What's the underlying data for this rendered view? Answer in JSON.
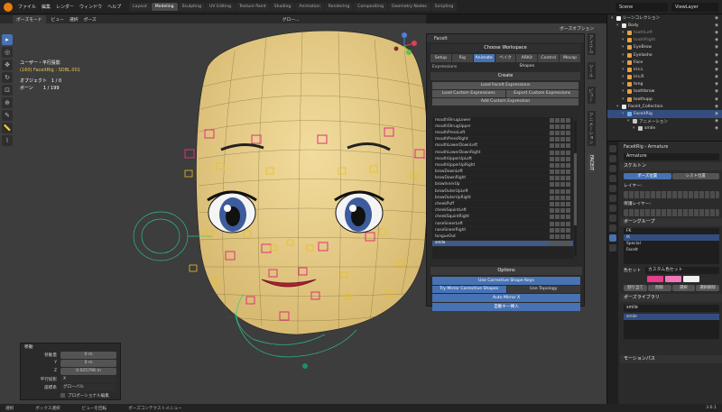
{
  "topbar": {
    "menu": [
      "ファイル",
      "編集",
      "レンダー",
      "ウィンドウ",
      "ヘルプ"
    ],
    "workspaces": [
      "Layout",
      "Modeling",
      "Sculpting",
      "UV Editing",
      "Texture Paint",
      "Shading",
      "Animation",
      "Rendering",
      "Compositing",
      "Geometry Nodes",
      "Scripting"
    ],
    "active_workspace": "Modeling",
    "scene": "Scene",
    "view_layer": "ViewLayer"
  },
  "viewport_header": {
    "mode": "ポーズモード",
    "items": [
      "ビュー",
      "選択",
      "ポーズ"
    ],
    "transform": "グロー...",
    "pose_options": "ポーズオプション"
  },
  "overlay": {
    "line1": "ユーザー・平行投影",
    "line2": "(160) FaceitRig : SDBL.001",
    "line3_label": "オブジェクト",
    "line3_value": "1 / 0",
    "line4_label": "ボーン",
    "line4_value": "1 / 199"
  },
  "faceit": {
    "header": "FaceIt",
    "workspace_title": "Choose Workspace",
    "tabs": [
      "Setup",
      "Rig",
      "Animate",
      "ベイク",
      "ARKit Shapes",
      "Control",
      "Mocap"
    ],
    "active_tab": "Animate",
    "expressions_label": "Expressions",
    "create_label": "Create",
    "load_preset": "Load FaceIt Expressions",
    "load_custom": "Load Custom Expressions",
    "export_custom": "Export Custom Expressions",
    "add_custom": "Add Custom Expression",
    "expressions": [
      "mouthShrugLower",
      "mouthShrugUpper",
      "mouthPressLeft",
      "mouthPressRight",
      "mouthLowerDownLeft",
      "mouthLowerDownRight",
      "mouthUpperUpLeft",
      "mouthUpperUpRight",
      "browDownLeft",
      "browDownRight",
      "browInnerUp",
      "browOuterUpLeft",
      "browOuterUpRight",
      "cheekPuff",
      "cheekSquintLeft",
      "cheekSquintRight",
      "noseSneerLeft",
      "noseSneerRight",
      "tongueOut",
      "smile"
    ],
    "selected_expression": "smile",
    "options_label": "Options",
    "opt1": "Use Corrective Shape Keys",
    "opt2": "Try Mirror Corrective Shapes",
    "opt3": "Use Topology",
    "opt4": "Auto Mirror X",
    "opt5": "自動キー挿入"
  },
  "side_tabs": [
    "アイテム",
    "ツール",
    "ビュー",
    "アニメーション",
    "FACEIT"
  ],
  "outliner": {
    "rows": [
      {
        "label": "シーンコレクション",
        "indent": 0,
        "color": "#ffffff",
        "dim": false,
        "sel": false
      },
      {
        "label": "Body",
        "indent": 1,
        "color": "#e8e8e8",
        "dim": false,
        "sel": false
      },
      {
        "label": "toothLeft",
        "indent": 2,
        "color": "#e8a040",
        "dim": true,
        "sel": false
      },
      {
        "label": "toothRight",
        "indent": 2,
        "color": "#e8a040",
        "dim": true,
        "sel": false
      },
      {
        "label": "EyeBrow",
        "indent": 2,
        "color": "#e8a040",
        "dim": false,
        "sel": false
      },
      {
        "label": "Eyelashe",
        "indent": 2,
        "color": "#e8a040",
        "dim": false,
        "sel": false
      },
      {
        "label": "Face",
        "indent": 2,
        "color": "#e8a040",
        "dim": false,
        "sel": false
      },
      {
        "label": "iris.L",
        "indent": 2,
        "color": "#e8a040",
        "dim": false,
        "sel": false
      },
      {
        "label": "iris.R",
        "indent": 2,
        "color": "#e8a040",
        "dim": false,
        "sel": false
      },
      {
        "label": "tong",
        "indent": 2,
        "color": "#e8a040",
        "dim": false,
        "sel": false
      },
      {
        "label": "toothbrow",
        "indent": 2,
        "color": "#e8a040",
        "dim": false,
        "sel": false
      },
      {
        "label": "toothupp",
        "indent": 2,
        "color": "#e8a040",
        "dim": false,
        "sel": false
      },
      {
        "label": "Faceit_Collection",
        "indent": 1,
        "color": "#e8e8e8",
        "dim": false,
        "sel": false
      },
      {
        "label": "FaceitRig",
        "indent": 2,
        "color": "#6fb0e8",
        "dim": false,
        "sel": true
      },
      {
        "label": "アニメーション",
        "indent": 3,
        "color": "#c8c8c8",
        "dim": false,
        "sel": false
      },
      {
        "label": "smile",
        "indent": 4,
        "color": "#c8c8c8",
        "dim": false,
        "sel": false
      }
    ]
  },
  "properties": {
    "breadcrumb_obj": "FaceitRig",
    "breadcrumb_data": "Armature",
    "data_name": "Armature",
    "skeleton_label": "スケルトン",
    "pose_pos": "ポーズ位置",
    "rest_pos": "レスト位置",
    "layers_label": "レイヤー:",
    "protected_label": "保護レイヤー:",
    "bone_groups_label": "ボーングループ",
    "bone_groups": [
      "FK",
      "IK",
      "Special",
      "FaceIt"
    ],
    "selected_group": "IK",
    "color_set_label": "色セット",
    "color_set_value": "カスタム色セット",
    "swatch_colors": [
      "#e83c8c",
      "#f078b8",
      "#f0f0f0"
    ],
    "assign": "割り当て",
    "remove": "削除",
    "select": "選択",
    "deselect": "選択解除",
    "pose_library_label": "ポーズライブラリ",
    "pose_library_value": "smile",
    "pose_item": "smile",
    "motion_paths_label": "モーションパス"
  },
  "adjust": {
    "header": "移動",
    "move_label": "移動量",
    "x": "0 m",
    "y": "0 m",
    "z": "0.025798 m",
    "axis_label": "平行投影",
    "axis_value": "X",
    "orient_label": "座標系",
    "orient_value": "グローバル",
    "proportional": "プロポーショナル編集"
  },
  "status": {
    "s1": "選択",
    "s2": "ボックス選択",
    "s3": "ビューを回転",
    "s4": "ポーズコンテクストメニュー",
    "version": "3.6.1"
  }
}
